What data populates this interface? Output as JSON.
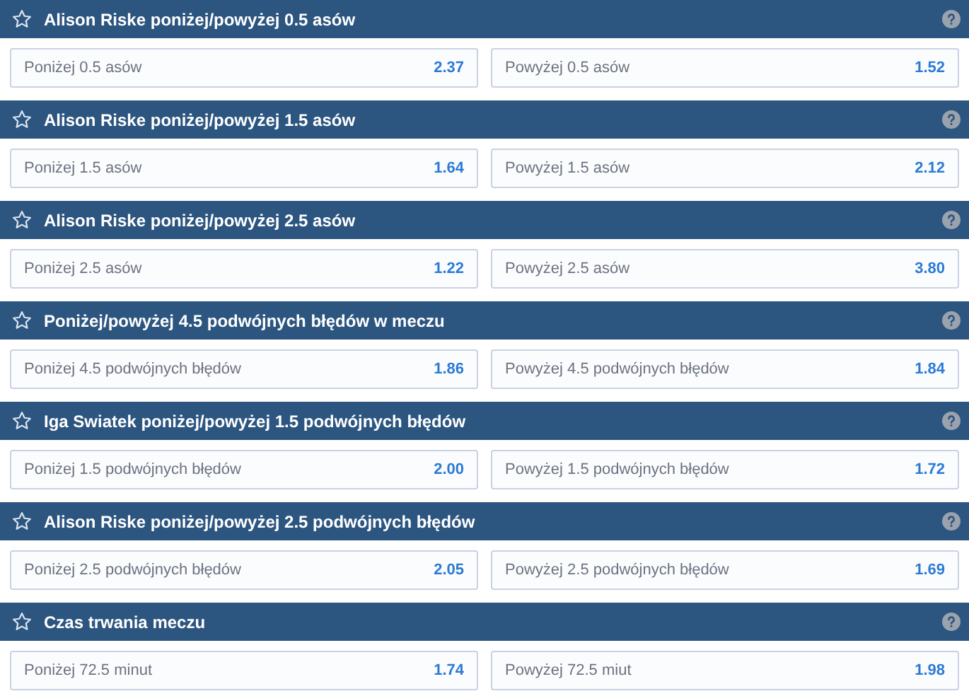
{
  "markets": [
    {
      "title": "Alison Riske poniżej/powyżej 0.5 asów",
      "options": [
        {
          "label": "Poniżej 0.5 asów",
          "odds": "2.37"
        },
        {
          "label": "Powyżej 0.5 asów",
          "odds": "1.52"
        }
      ]
    },
    {
      "title": "Alison Riske poniżej/powyżej 1.5 asów",
      "options": [
        {
          "label": "Poniżej 1.5 asów",
          "odds": "1.64"
        },
        {
          "label": "Powyżej 1.5 asów",
          "odds": "2.12"
        }
      ]
    },
    {
      "title": "Alison Riske poniżej/powyżej 2.5 asów",
      "options": [
        {
          "label": "Poniżej 2.5 asów",
          "odds": "1.22"
        },
        {
          "label": "Powyżej 2.5 asów",
          "odds": "3.80"
        }
      ]
    },
    {
      "title": "Poniżej/powyżej 4.5 podwójnych błędów w meczu",
      "options": [
        {
          "label": "Poniżej 4.5 podwójnych błędów",
          "odds": "1.86"
        },
        {
          "label": "Powyżej 4.5 podwójnych błędów",
          "odds": "1.84"
        }
      ]
    },
    {
      "title": "Iga Swiatek poniżej/powyżej 1.5 podwójnych błędów",
      "options": [
        {
          "label": "Poniżej 1.5 podwójnych błędów",
          "odds": "2.00"
        },
        {
          "label": "Powyżej 1.5 podwójnych błędów",
          "odds": "1.72"
        }
      ]
    },
    {
      "title": "Alison Riske poniżej/powyżej 2.5 podwójnych błędów",
      "options": [
        {
          "label": "Poniżej 2.5 podwójnych błędów",
          "odds": "2.05"
        },
        {
          "label": "Powyżej 2.5 podwójnych błędów",
          "odds": "1.69"
        }
      ]
    },
    {
      "title": "Czas trwania meczu",
      "options": [
        {
          "label": "Poniżej 72.5 minut",
          "odds": "1.74"
        },
        {
          "label": "Powyżej 72.5 miut",
          "odds": "1.98"
        }
      ]
    }
  ]
}
